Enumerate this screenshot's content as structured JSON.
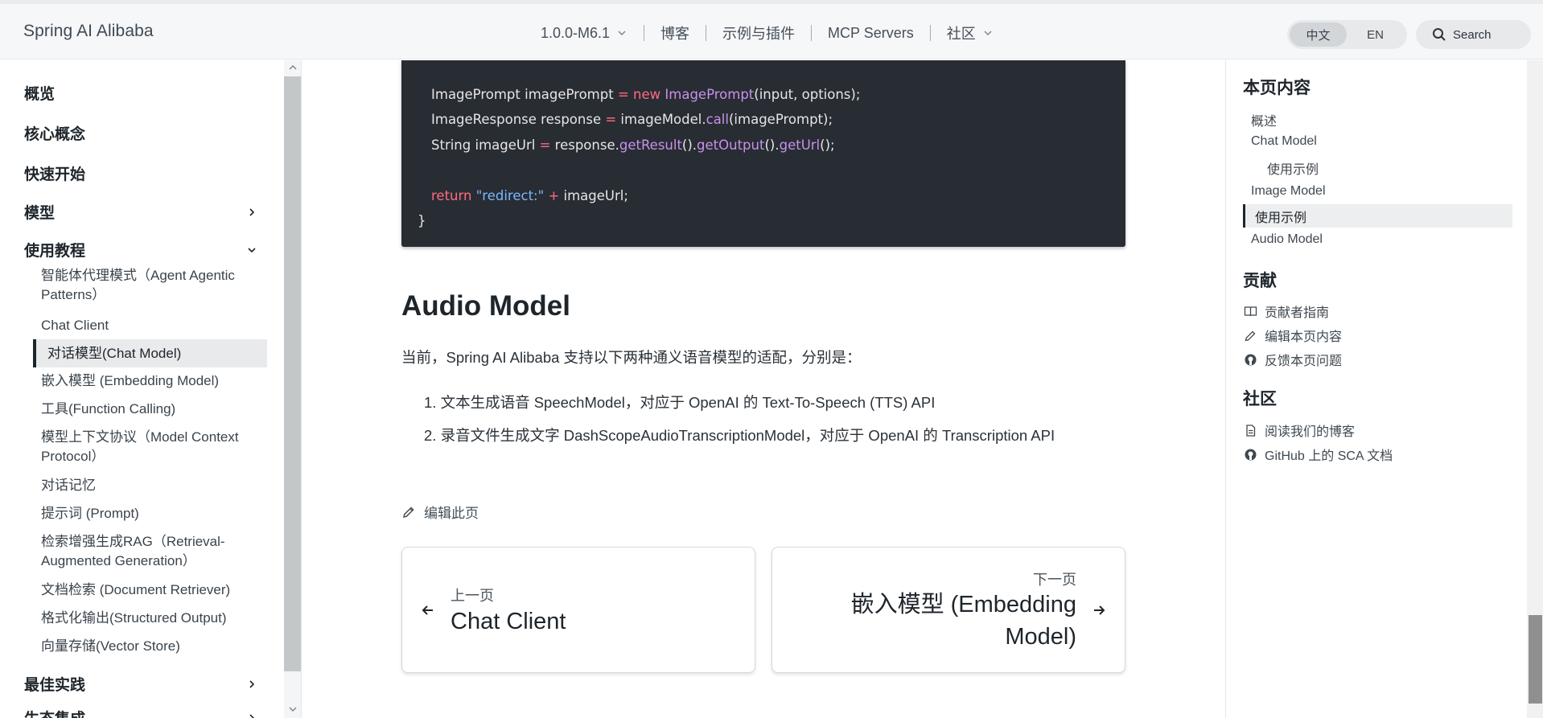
{
  "header": {
    "brand": "Spring AI Alibaba",
    "nav": [
      "1.0.0-M6.1",
      "博客",
      "示例与插件",
      "MCP Servers",
      "社区"
    ],
    "lang": [
      "中文",
      "EN"
    ],
    "search": "Search"
  },
  "sidebar": {
    "sections": [
      "概览",
      "核心概念",
      "快速开始",
      "模型",
      "使用教程"
    ],
    "items": [
      "智能体代理模式（Agent Agentic Patterns）",
      "Chat Client",
      "对话模型(Chat Model)",
      "嵌入模型 (Embedding Model)",
      "工具(Function Calling)",
      "模型上下文协议（Model Context Protocol）",
      "对话记忆",
      "提示词 (Prompt)",
      "检索增强生成RAG（Retrieval-Augmented Generation）",
      "文档检索 (Document Retriever)",
      "格式化输出(Structured Output)",
      "向量存储(Vector Store)"
    ],
    "after": [
      "最佳实践",
      "生态集成"
    ]
  },
  "code": {
    "l1": [
      "ImagePrompt imagePrompt ",
      "=",
      " ",
      "new",
      " ",
      "ImagePrompt",
      "(input, options);"
    ],
    "l2": [
      "ImageResponse response ",
      "=",
      " imageModel.",
      "call",
      "(imagePrompt);"
    ],
    "l3": [
      "String imageUrl ",
      "=",
      " response.",
      "getResult",
      "().",
      "getOutput",
      "().",
      "getUrl",
      "();"
    ],
    "l4": [
      "return",
      " ",
      "\"redirect:\"",
      " ",
      "+",
      " imageUrl;"
    ],
    "l5": "}"
  },
  "content": {
    "title": "Audio Model",
    "intro": "当前，Spring AI Alibaba 支持以下两种通义语音模型的适配，分别是：",
    "list": [
      "1. 文本生成语音 SpeechModel，对应于 OpenAI 的 Text-To-Speech (TTS) API",
      "2. 录音文件生成文字 DashScopeAudioTranscriptionModel，对应于 OpenAI 的 Transcription API"
    ],
    "edit": "编辑此页",
    "prev_label": "上一页",
    "prev_title": "Chat Client",
    "next_label": "下一页",
    "next_title_1": "嵌入模型 (Embedding",
    "next_title_2": "Model)"
  },
  "toc": {
    "heading": "本页内容",
    "items": [
      "概述",
      "Chat Model",
      "使用示例",
      "Image Model",
      "使用示例",
      "Audio Model"
    ],
    "contrib_heading": "贡献",
    "contrib": [
      "贡献者指南",
      "编辑本页内容",
      "反馈本页问题"
    ],
    "community_heading": "社区",
    "community": [
      "阅读我们的博客",
      "GitHub 上的 SCA 文档"
    ]
  }
}
